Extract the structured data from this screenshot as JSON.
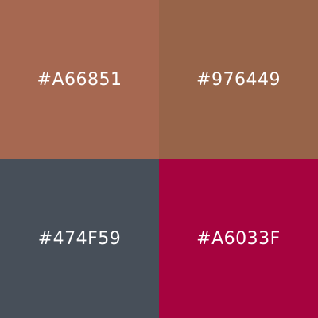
{
  "swatches": [
    {
      "label": "#A66851",
      "color": "#A66851"
    },
    {
      "label": "#976449",
      "color": "#976449"
    },
    {
      "label": "#474F59",
      "color": "#474F59"
    },
    {
      "label": "#A6033F",
      "color": "#A6033F"
    }
  ]
}
